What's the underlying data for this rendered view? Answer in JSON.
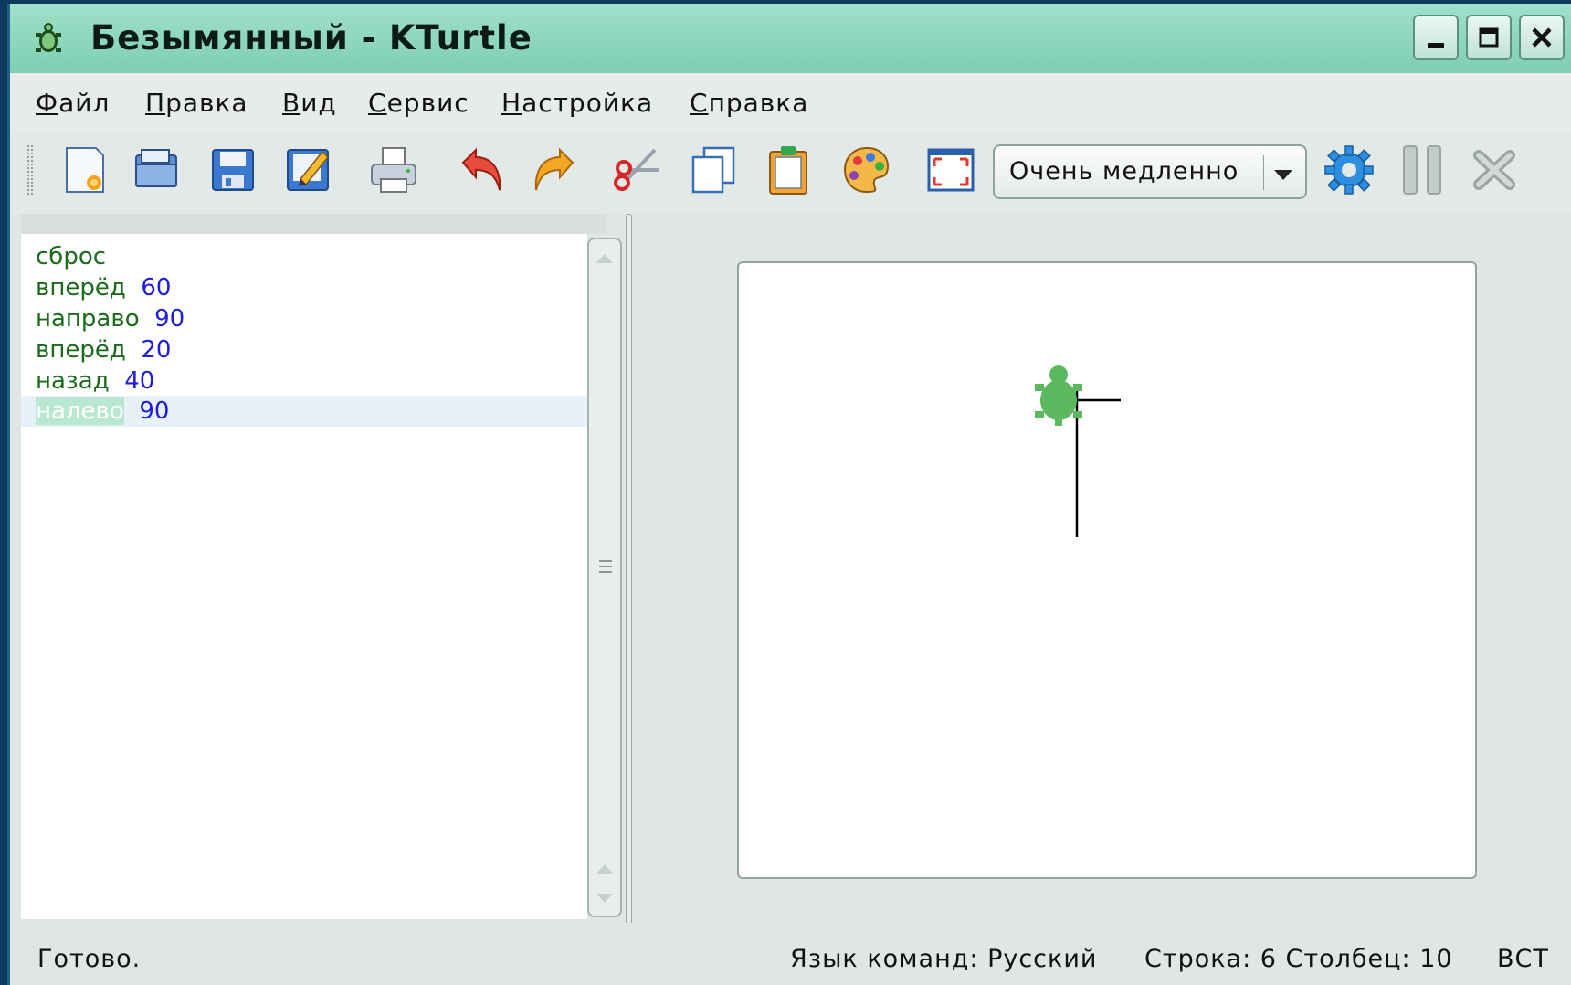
{
  "window": {
    "title": "Безымянный - KTurtle"
  },
  "menu": [
    "Файл",
    "Правка",
    "Вид",
    "Сервис",
    "Настройка",
    "Справка"
  ],
  "toolbar": {
    "icons": [
      "new-file-icon",
      "open-file-icon",
      "save-icon",
      "save-as-icon",
      "print-icon",
      "undo-icon",
      "redo-icon",
      "cut-icon",
      "copy-icon",
      "paste-icon",
      "color-picker-icon",
      "fullscreen-icon"
    ],
    "speed": "Очень медленно",
    "run_icon": "gear-icon",
    "pause_icon": "pause-icon",
    "abort_icon": "abort-icon"
  },
  "editor": {
    "lines": [
      {
        "cmd": "сброс",
        "arg": ""
      },
      {
        "cmd": "вперёд",
        "arg": "60"
      },
      {
        "cmd": "направо",
        "arg": "90"
      },
      {
        "cmd": "вперёд",
        "arg": "20"
      },
      {
        "cmd": "назад",
        "arg": "40"
      },
      {
        "cmd": "налево",
        "arg": "90"
      }
    ],
    "colors": {
      "keyword": "#1a6b1a",
      "number": "#1d1ddb",
      "current_line": "#e8f1f7"
    }
  },
  "status": {
    "message": "Готово.",
    "language": "Язык команд: Русский",
    "position": "Строка: 6 Столбец: 10",
    "mode": "ВСТ"
  },
  "colors": {
    "titlebar": "#8fd8be",
    "turtle": "#5cb85c",
    "background": "#0b3a5e"
  }
}
